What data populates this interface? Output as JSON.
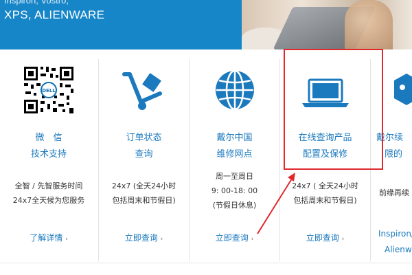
{
  "banner": {
    "cut_text": "Inspiron, Vostro,",
    "text": "XPS, ALIENWARE"
  },
  "cards": [
    {
      "icon": "qr-code-icon",
      "title_line1": "微　信",
      "title_line2": "技术支持",
      "desc_line1": "全智 / 先智服务时间",
      "desc_line2": "24x7全天候为您服务",
      "desc_line3": "",
      "link": "了解详情"
    },
    {
      "icon": "hand-truck-icon",
      "title_line1": "订单状态",
      "title_line2": "查询",
      "desc_line1": "24x7 (全天24小时",
      "desc_line2": "包括周末和节假日)",
      "desc_line3": "",
      "link": "立即查询"
    },
    {
      "icon": "globe-icon",
      "title_line1": "戴尔中国",
      "title_line2": "维修网点",
      "desc_line1": "周一至周日",
      "desc_line2": "9: 00-18: 00",
      "desc_line3": "(节假日休息)",
      "link": "立即查询"
    },
    {
      "icon": "laptop-icon",
      "title_line1": "在线查询产品",
      "title_line2": "配置及保修",
      "desc_line1": "24x7 ( 全天24小时",
      "desc_line2": "包括周末和节假日)",
      "desc_line3": "",
      "link": "立即查询"
    }
  ],
  "edge_card": {
    "icon": "tag-icon",
    "title_line1": "戴尔续",
    "title_line2": "限的",
    "desc": "前缘再续",
    "link1": "Inspiron/",
    "link2": "Alienw"
  },
  "colors": {
    "banner": "#1786c9",
    "link": "#1b79bd",
    "highlight": "#e0282d"
  }
}
